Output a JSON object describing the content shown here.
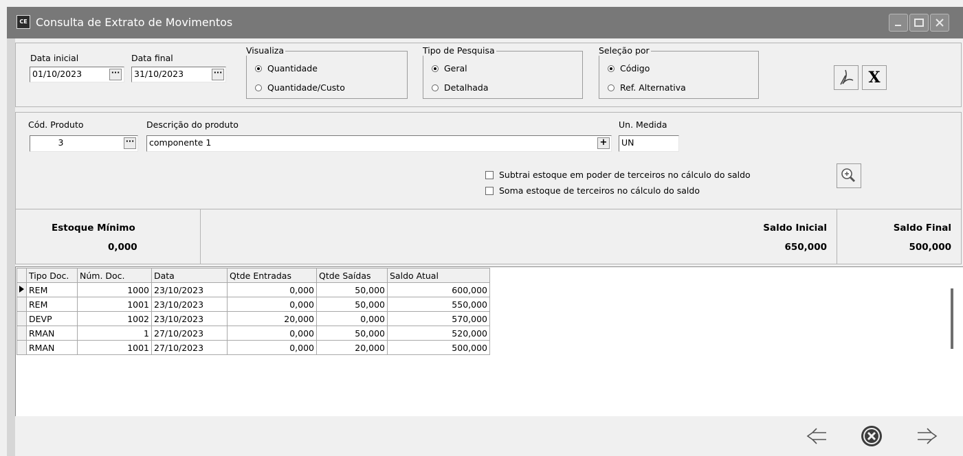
{
  "window": {
    "title": "Consulta de Extrato de Movimentos",
    "icon_text": "CE",
    "icons": [
      "app-icon",
      "minimize-icon",
      "maximize-icon",
      "close-icon"
    ]
  },
  "filters": {
    "data_inicial_label": "Data inicial",
    "data_inicial_value": "01/10/2023",
    "data_final_label": "Data final",
    "data_final_value": "31/10/2023",
    "dots": "···",
    "visualiza": {
      "title": "Visualiza",
      "options": [
        "Quantidade",
        "Quantidade/Custo"
      ],
      "selected": "Quantidade"
    },
    "tipo_pesquisa": {
      "title": "Tipo de Pesquisa",
      "options": [
        "Geral",
        "Detalhada"
      ],
      "selected": "Geral"
    },
    "selecao_por": {
      "title": "Seleção por",
      "options": [
        "Código",
        "Ref. Alternativa"
      ],
      "selected": "Código"
    },
    "pdf_icon": "pdf-icon",
    "excel_icon_text": "X"
  },
  "product": {
    "cod_label": "Cód. Produto",
    "cod_value": "3",
    "desc_label": "Descrição do produto",
    "desc_value": "componente 1",
    "plus": "+",
    "un_label": "Un. Medida",
    "un_value": "UN",
    "check_subtrai": "Subtrai estoque em poder de terceiros no cálculo do saldo",
    "check_soma": "Soma estoque de terceiros no cálculo do saldo",
    "zoom_icon": "magnifier-plus-icon"
  },
  "summary": {
    "estoque_min_label": "Estoque Mínimo",
    "estoque_min_value": "0,000",
    "saldo_inicial_label": "Saldo Inicial",
    "saldo_inicial_value": "650,000",
    "saldo_final_label": "Saldo Final",
    "saldo_final_value": "500,000"
  },
  "grid": {
    "columns": [
      "Tipo Doc.",
      "Núm. Doc.",
      "Data",
      "Qtde Entradas",
      "Qtde Saídas",
      "Saldo Atual"
    ],
    "rows": [
      [
        "REM",
        "1000",
        "23/10/2023",
        "0,000",
        "50,000",
        "600,000"
      ],
      [
        "REM",
        "1001",
        "23/10/2023",
        "0,000",
        "50,000",
        "550,000"
      ],
      [
        "DEVP",
        "1002",
        "23/10/2023",
        "20,000",
        "0,000",
        "570,000"
      ],
      [
        "RMAN",
        "1",
        "27/10/2023",
        "0,000",
        "50,000",
        "520,000"
      ],
      [
        "RMAN",
        "1001",
        "27/10/2023",
        "0,000",
        "20,000",
        "500,000"
      ]
    ],
    "current_row": 0
  },
  "nav": {
    "icons": [
      "arrow-left-icon",
      "cancel-icon",
      "arrow-right-icon"
    ]
  }
}
